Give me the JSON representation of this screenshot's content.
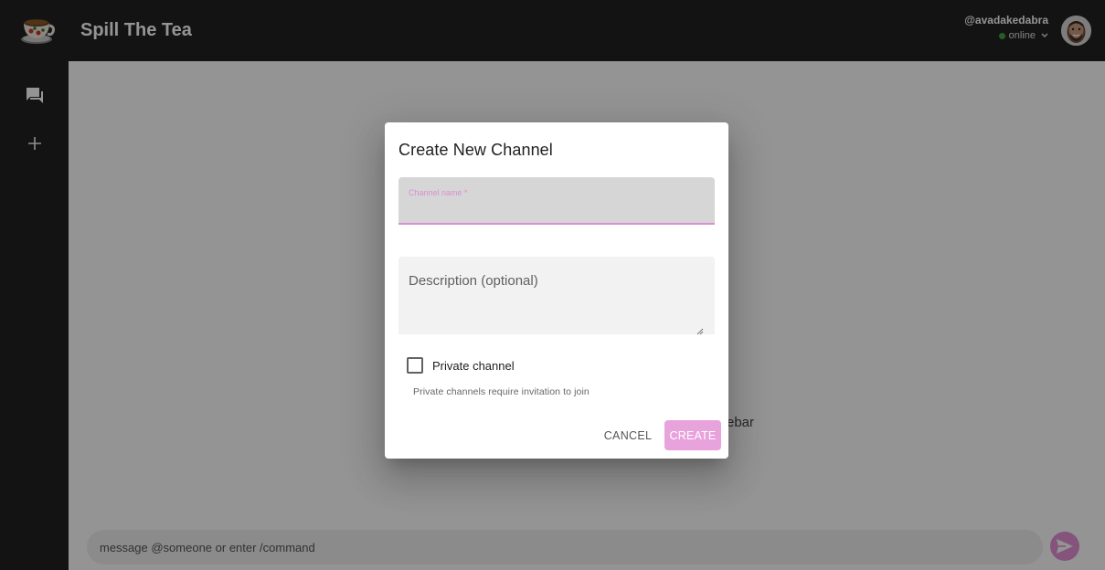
{
  "header": {
    "app_title": "Spill The Tea",
    "username": "@avadakedabra",
    "status": "online"
  },
  "main": {
    "hint_text": "ebar",
    "composer_placeholder": "message @someone or enter /command"
  },
  "dialog": {
    "title": "Create New Channel",
    "name_label": "Channel name *",
    "name_value": "",
    "description_placeholder": "Description (optional)",
    "private_label": "Private channel",
    "private_checked": false,
    "helper_text": "Private channels require invitation to join",
    "cancel_label": "CANCEL",
    "create_label": "CREATE"
  },
  "colors": {
    "topbar_bg": "#212121",
    "accent": "#d98fd0",
    "create_button": "#e8a3dd",
    "send_button": "#e391d6",
    "status_online": "#43a047"
  },
  "icons": {
    "logo": "teacup-logo-icon",
    "channels": "forum-icon",
    "add": "plus-icon",
    "send": "send-icon",
    "dropdown": "chevron-down-icon"
  }
}
